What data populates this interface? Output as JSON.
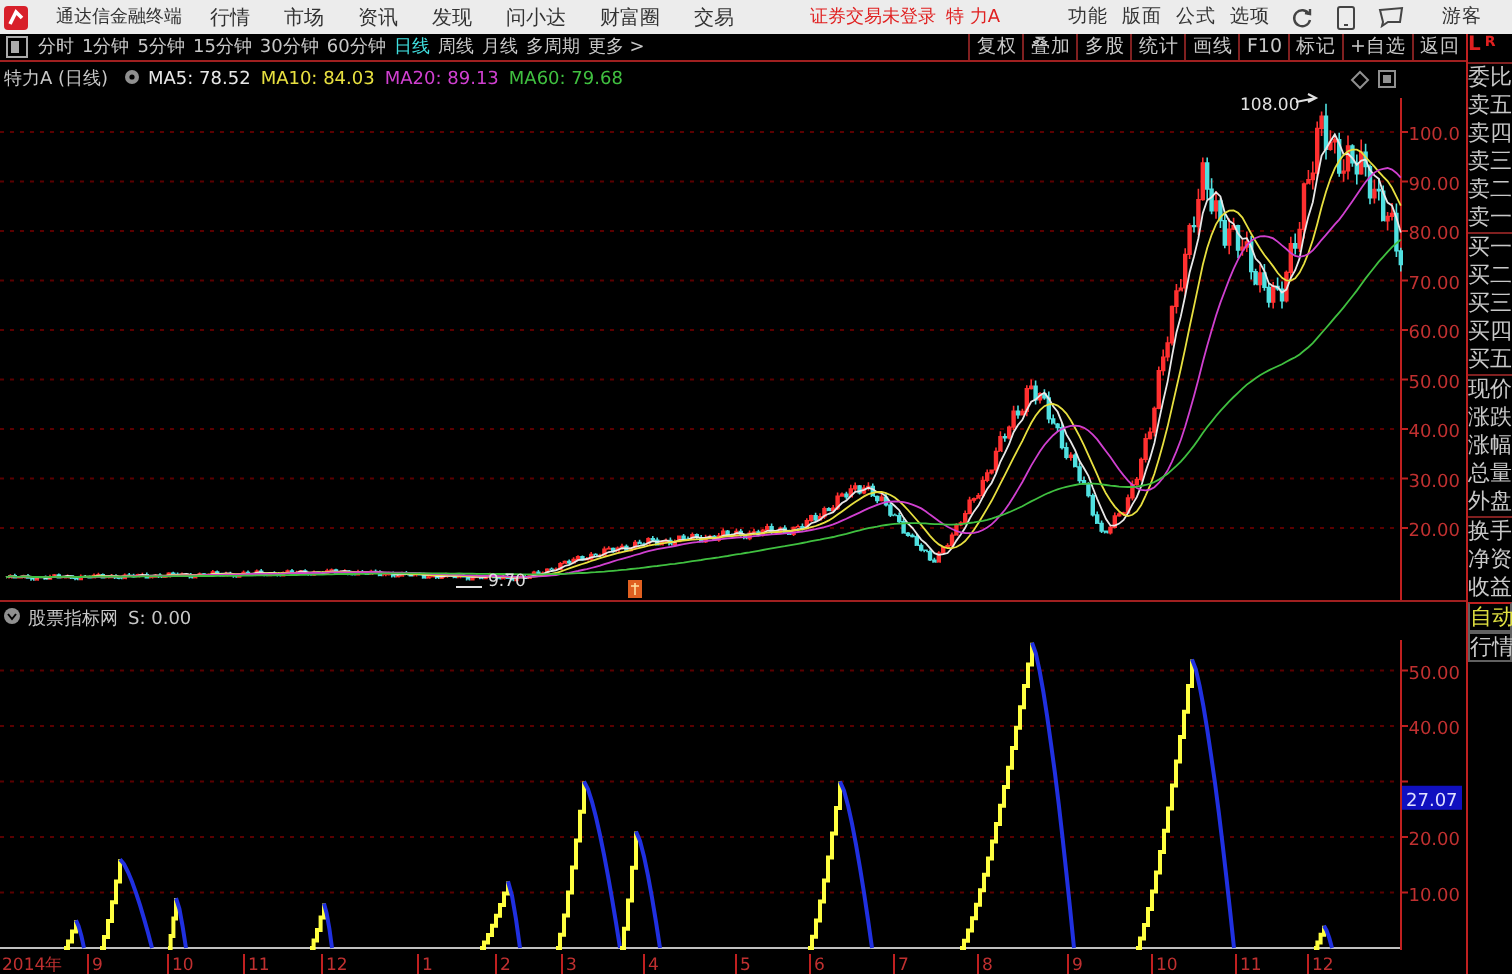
{
  "app": {
    "title": "通达信金融终端"
  },
  "menu": [
    "行情",
    "市场",
    "资讯",
    "发现",
    "问小达",
    "财富圈",
    "交易"
  ],
  "login_status": "证券交易未登录",
  "stock_name": "特 力A",
  "right_menu": [
    "功能",
    "版面",
    "公式",
    "选项"
  ],
  "user": "游客",
  "periods": [
    {
      "label": "分时",
      "selected": false
    },
    {
      "label": "1分钟",
      "selected": false
    },
    {
      "label": "5分钟",
      "selected": false
    },
    {
      "label": "15分钟",
      "selected": false
    },
    {
      "label": "30分钟",
      "selected": false
    },
    {
      "label": "60分钟",
      "selected": false
    },
    {
      "label": "日线",
      "selected": true
    },
    {
      "label": "周线",
      "selected": false
    },
    {
      "label": "月线",
      "selected": false
    },
    {
      "label": "多周期",
      "selected": false
    },
    {
      "label": "更多 >",
      "selected": false
    }
  ],
  "tools": [
    "复权",
    "叠加",
    "多股",
    "统计",
    "画线",
    "F10",
    "标记",
    "+自选",
    "返回"
  ],
  "price_pane": {
    "title": "特力A (日线)",
    "ma": [
      {
        "label": "MA5: 78.52",
        "color": "#e8e8e8"
      },
      {
        "label": "MA10: 84.03",
        "color": "#e8e040"
      },
      {
        "label": "MA20: 89.13",
        "color": "#d040d0"
      },
      {
        "label": "MA60: 79.68",
        "color": "#40c040"
      }
    ],
    "high_label": "108.00",
    "low_label": "9.70",
    "y_labels": [
      "100.0",
      "90.00",
      "80.00",
      "70.00",
      "60.00",
      "50.00",
      "40.00",
      "30.00",
      "20.00"
    ]
  },
  "indicator_pane": {
    "title": "股票指标网",
    "value": "S: 0.00",
    "y_labels": [
      "50.00",
      "40.00",
      "20.00",
      "10.00"
    ],
    "current": "27.07"
  },
  "x_labels": [
    "2014年",
    "9",
    "10",
    "11",
    "12",
    "1",
    "2",
    "3",
    "4",
    "5",
    "6",
    "7",
    "8",
    "9",
    "10",
    "11",
    "12"
  ],
  "quote_panel": {
    "left": "L",
    "right": "R",
    "groups": [
      [
        "委比",
        "卖五",
        "卖四",
        "卖三",
        "卖二",
        "卖一"
      ],
      [
        "买一",
        "买二",
        "买三",
        "买四",
        "买五"
      ],
      [
        "现价",
        "涨跌",
        "涨幅",
        "总量",
        "外盘"
      ],
      [
        "换手",
        "净资",
        "收益"
      ]
    ],
    "buttons": [
      "自动",
      "行情"
    ]
  }
}
